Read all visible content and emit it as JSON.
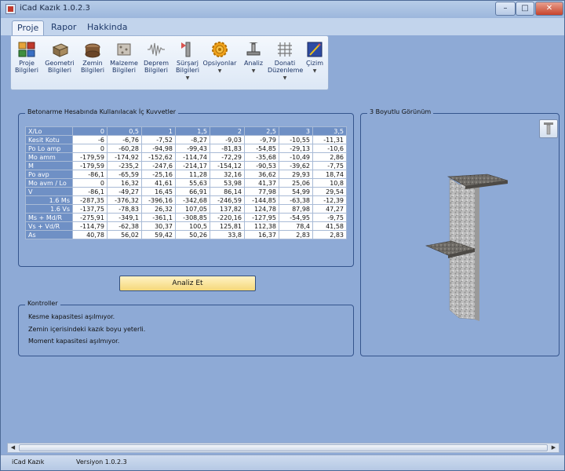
{
  "window": {
    "title": "iCad Kazık 1.0.2.3"
  },
  "menu": {
    "tabs": [
      "Proje",
      "Rapor",
      "Hakkinda"
    ]
  },
  "ribbon": {
    "buttons": [
      {
        "line1": "Proje",
        "line2": "Bilgileri",
        "icon": "project-info-icon"
      },
      {
        "line1": "Geometri",
        "line2": "Bilgileri",
        "icon": "geometry-icon"
      },
      {
        "line1": "Zemin",
        "line2": "Bilgileri",
        "icon": "soil-icon"
      },
      {
        "line1": "Malzeme",
        "line2": "Bilgileri",
        "icon": "material-icon"
      },
      {
        "line1": "Deprem",
        "line2": "Bilgileri",
        "icon": "earthquake-icon"
      },
      {
        "line1": "Sürşarj",
        "line2": "Bilgileri",
        "icon": "surcharge-icon"
      },
      {
        "line1": "Opsiyonlar",
        "line2": "",
        "icon": "options-gear-icon"
      },
      {
        "line1": "Analiz",
        "line2": "",
        "icon": "analysis-icon"
      },
      {
        "line1": "Donati",
        "line2": "Düzenleme",
        "icon": "rebar-grid-icon"
      },
      {
        "line1": "Çizim",
        "line2": "",
        "icon": "drawing-icon"
      }
    ]
  },
  "forces": {
    "title": "Betonarme Hesabında Kullanılacak  İç Kuvvetler",
    "header": [
      "X/Lo",
      "0",
      "0,5",
      "1",
      "1,5",
      "2",
      "2,5",
      "3",
      "3,5"
    ],
    "rows": [
      {
        "label": "Kesit Kotu",
        "values": [
          "-6",
          "-6,76",
          "-7,52",
          "-8,27",
          "-9,03",
          "-9,79",
          "-10,55",
          "-11,31"
        ]
      },
      {
        "label": "Po Lo amp",
        "values": [
          "0",
          "-60,28",
          "-94,98",
          "-99,43",
          "-81,83",
          "-54,85",
          "-29,13",
          "-10,6"
        ]
      },
      {
        "label": "Mo amm",
        "values": [
          "-179,59",
          "-174,92",
          "-152,62",
          "-114,74",
          "-72,29",
          "-35,68",
          "-10,49",
          "2,86"
        ]
      },
      {
        "label": "M",
        "values": [
          "-179,59",
          "-235,2",
          "-247,6",
          "-214,17",
          "-154,12",
          "-90,53",
          "-39,62",
          "-7,75"
        ]
      },
      {
        "label": "Po avp",
        "values": [
          "-86,1",
          "-65,59",
          "-25,16",
          "11,28",
          "32,16",
          "36,62",
          "29,93",
          "18,74"
        ]
      },
      {
        "label": "Mo avm / Lo",
        "values": [
          "0",
          "16,32",
          "41,61",
          "55,63",
          "53,98",
          "41,37",
          "25,06",
          "10,8"
        ]
      },
      {
        "label": "V",
        "values": [
          "-86,1",
          "-49,27",
          "16,45",
          "66,91",
          "86,14",
          "77,98",
          "54,99",
          "29,54"
        ]
      },
      {
        "label": "1.6 Ms",
        "values": [
          "-287,35",
          "-376,32",
          "-396,16",
          "-342,68",
          "-246,59",
          "-144,85",
          "-63,38",
          "-12,39"
        ],
        "right": true
      },
      {
        "label": "1.6 Vs",
        "values": [
          "-137,75",
          "-78,83",
          "26,32",
          "107,05",
          "137,82",
          "124,78",
          "87,98",
          "47,27"
        ],
        "right": true
      },
      {
        "label": "Ms + Md/R",
        "values": [
          "-275,91",
          "-349,1",
          "-361,1",
          "-308,85",
          "-220,16",
          "-127,95",
          "-54,95",
          "-9,75"
        ]
      },
      {
        "label": "Vs + Vd/R",
        "values": [
          "-114,79",
          "-62,38",
          "30,37",
          "100,5",
          "125,81",
          "112,38",
          "78,4",
          "41,58"
        ]
      },
      {
        "label": "As",
        "values": [
          "40,78",
          "56,02",
          "59,42",
          "50,26",
          "33,8",
          "16,37",
          "2,83",
          "2,83"
        ]
      }
    ]
  },
  "actions": {
    "analyze": "Analiz Et"
  },
  "controls": {
    "title": "Kontroller",
    "lines": [
      "Kesme kapasitesi aşılmıyor.",
      "Zemin içerisindeki kazık boyu yeterli.",
      "Moment kapasitesi aşılmıyor."
    ]
  },
  "view3d": {
    "title": "3 Boyutlu Görünüm"
  },
  "status": {
    "app": "iCad Kazık",
    "version": "Versiyon 1.0.2.3"
  }
}
